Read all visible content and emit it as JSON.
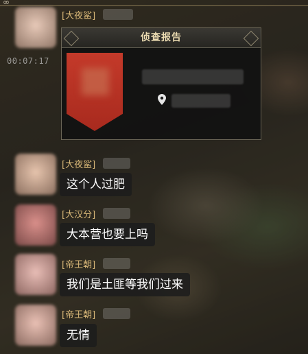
{
  "top_bar": {
    "icon": "infinity-icon",
    "icon_glyph": "∞"
  },
  "timer": "00:07:17",
  "scout_report": {
    "title": "侦查报告",
    "emblem_color": "#c43a2a",
    "location_icon": "map-pin-icon"
  },
  "messages": [
    {
      "name": "[大夜鲨]",
      "text": ""
    },
    {
      "name": "[大夜鲨]",
      "text": "这个人过肥"
    },
    {
      "name": "[大汉分]",
      "text": "大本营也要上吗"
    },
    {
      "name": "[帝王朝]",
      "text": "我们是土匪等我们过来"
    },
    {
      "name": "[帝王朝]",
      "text": "无情"
    }
  ],
  "colors": {
    "name_gold": "#d9b878",
    "bubble_bg": "#1c1c1c",
    "text": "#ffffff"
  }
}
